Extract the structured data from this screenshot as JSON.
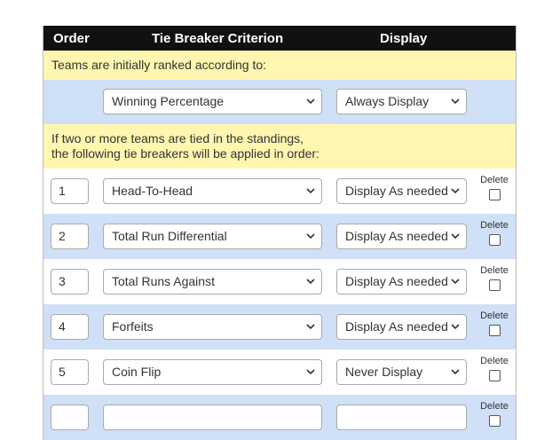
{
  "header": {
    "order": "Order",
    "criterion": "Tie Breaker Criterion",
    "display": "Display"
  },
  "intro_text": "Teams are initially ranked according to:",
  "primary": {
    "criterion": "Winning Percentage",
    "display": "Always Display"
  },
  "tie_text": {
    "line1": "If two or more teams are tied in the standings,",
    "line2": "the following tie breakers will be applied in order:"
  },
  "delete_label": "Delete",
  "rows": [
    {
      "order": "1",
      "criterion": "Head-To-Head",
      "display": "Display As needed"
    },
    {
      "order": "2",
      "criterion": "Total Run Differential",
      "display": "Display As needed"
    },
    {
      "order": "3",
      "criterion": "Total Runs Against",
      "display": "Display As needed"
    },
    {
      "order": "4",
      "criterion": "Forfeits",
      "display": "Display As needed"
    },
    {
      "order": "5",
      "criterion": "Coin Flip",
      "display": "Never Display"
    },
    {
      "order": "",
      "criterion": "",
      "display": ""
    }
  ],
  "icons": {
    "dropdown": "chevron-down-icon"
  }
}
